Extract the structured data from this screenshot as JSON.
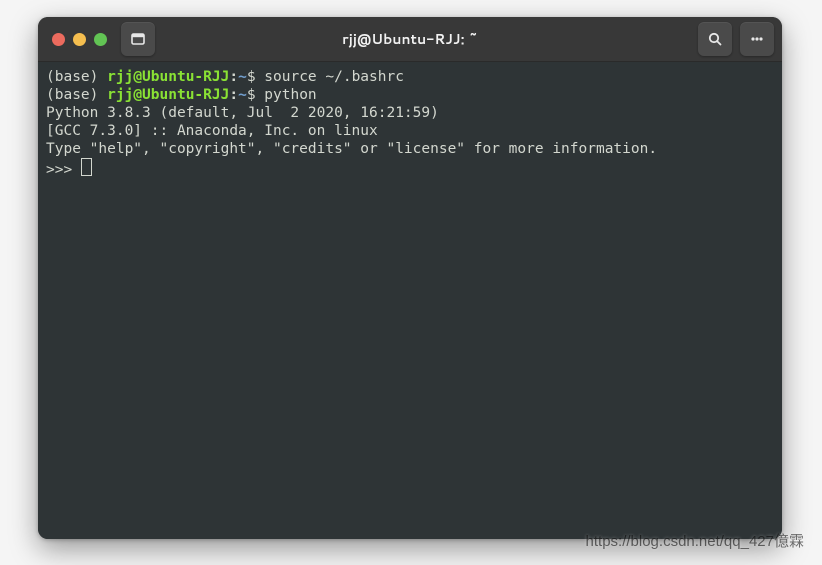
{
  "titlebar": {
    "title": "rjj@Ubuntu-RJJ: ~"
  },
  "shell": {
    "env": "(base)",
    "user_host": "rjj@Ubuntu-RJJ",
    "path": "~",
    "prompt": "$"
  },
  "lines": {
    "cmd1": "source ~/.bashrc",
    "cmd2": "python",
    "out1": "Python 3.8.3 (default, Jul  2 2020, 16:21:59) ",
    "out2": "[GCC 7.3.0] :: Anaconda, Inc. on linux",
    "out3": "Type \"help\", \"copyright\", \"credits\" or \"license\" for more information.",
    "pyprompt": ">>> "
  },
  "watermark": "https://blog.csdn.net/qq_427億霖"
}
